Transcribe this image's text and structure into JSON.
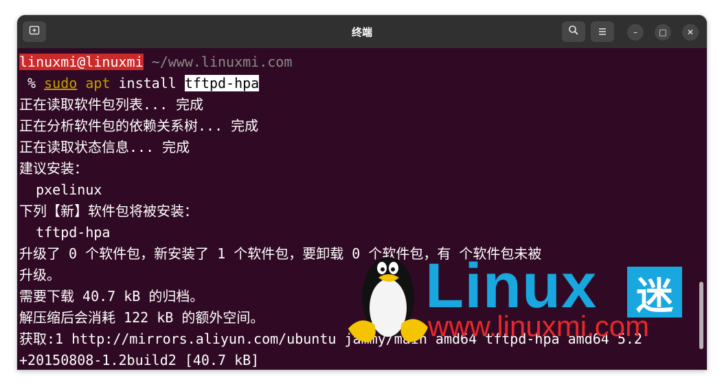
{
  "window": {
    "title": "终端"
  },
  "titlebar": {
    "new_tab_icon": "new-tab-icon",
    "search_icon": "search-icon",
    "menu_icon": "hamburger-menu-icon",
    "minimize_glyph": "–",
    "maximize_glyph": "□",
    "close_glyph": "✕"
  },
  "prompt": {
    "user_host": "linuxmi@linuxmi",
    "path": " ~/www.linuxmi.com",
    "symbol": " % ",
    "cmd_sudo": "sudo",
    "space1": " ",
    "cmd_apt": "apt",
    "cmd_install": " install ",
    "cmd_pkg": "tftpd-hpa"
  },
  "output": [
    "正在读取软件包列表... 完成",
    "正在分析软件包的依赖关系树... 完成",
    "正在读取状态信息... 完成",
    "建议安装：",
    "  pxelinux",
    "下列【新】软件包将被安装：",
    "  tftpd-hpa",
    "升级了 0 个软件包，新安装了 1 个软件包，要卸载 0 个软件包，有 个软件包未被",
    "升级。",
    "需要下载 40.7 kB 的归档。",
    "解压缩后会消耗 122 kB 的额外空间。",
    "获取:1 http://mirrors.aliyun.com/ubuntu jammy/main amd64 tftpd-hpa amd64 5.2",
    "+20150808-1.2build2 [40.7 kB]"
  ],
  "watermark": {
    "brand": "Linux",
    "brand_mi": "迷",
    "url": "www.linuxmi.com"
  },
  "colors": {
    "terminal_bg": "#300a24",
    "titlebar_bg": "#303030",
    "user_highlight": "#cc2a2a",
    "command_yellow": "#c4a000",
    "watermark_blue": "#19a7e0",
    "watermark_red": "#e8282c"
  }
}
